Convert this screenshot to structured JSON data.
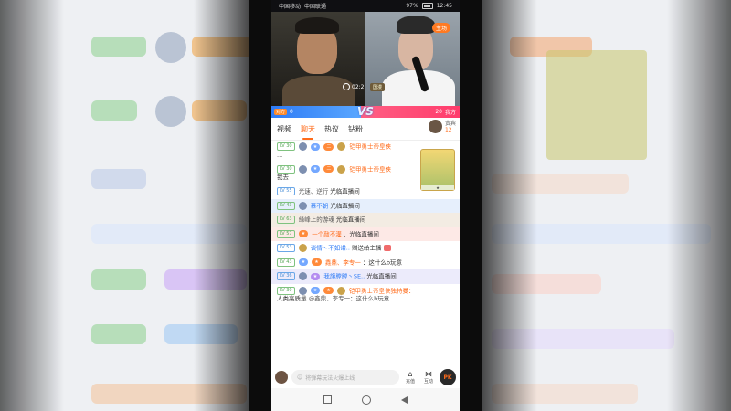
{
  "status_bar": {
    "carrier_line1": "中国移动",
    "carrier_line2": "中国联通",
    "battery_pct": "97%",
    "time": "12:45"
  },
  "video": {
    "host_tag": "主场",
    "timer": "02:2",
    "cam_tag": "国漫"
  },
  "pk_bar": {
    "left_label": "对方",
    "left_score": "0",
    "vs": "VS",
    "right_score": "20",
    "right_label": "我方"
  },
  "tabs": [
    "视频",
    "聊天",
    "热议",
    "钻粉"
  ],
  "guest": {
    "label": "贵宾",
    "count": "12"
  },
  "chat": [
    {
      "level": "LV 30",
      "pill": "二",
      "name": "铠甲勇士帝皇侠",
      "text": "..."
    },
    {
      "level": "LV 30",
      "pill": "二",
      "name": "铠甲勇士帝皇侠",
      "text": "我去"
    },
    {
      "level": "LV 55",
      "name": "光速、逆行",
      "text": "光临直播间"
    },
    {
      "level": "LV 43",
      "name": "慕不朝",
      "text": "光临直播间"
    },
    {
      "level": "LV 63",
      "name": "缘峰上的游魂",
      "text": "光临直播间"
    },
    {
      "level": "LV 57",
      "name": "一个敲不灌",
      "text": "、光临直播间"
    },
    {
      "level": "LV 53",
      "name": "谈情丶不如诺..",
      "text": "赠送给主播"
    },
    {
      "level": "LV 43",
      "name": "鑫鼎、李专一",
      "text": "：这什么b玩意"
    },
    {
      "level": "LV 36",
      "name": "我旗膛膛丶SE..",
      "text": "光临直播间"
    },
    {
      "level": "LV 30",
      "name": "铠甲勇士帝皇侠独特曼：",
      "text": "人类高质量",
      "extra": "@鑫鼎、李专一：这什么b玩意"
    }
  ],
  "input": {
    "placeholder": "将弹幕玩法火爆上线"
  },
  "actions": [
    {
      "glyph": "⌂",
      "label": "充值"
    },
    {
      "glyph": "⋈",
      "label": "互动"
    }
  ],
  "pk_button": "PK",
  "colors": {
    "accent": "#ff6b1a",
    "blue": "#2f7cf6",
    "pink": "#ff3c6c"
  }
}
